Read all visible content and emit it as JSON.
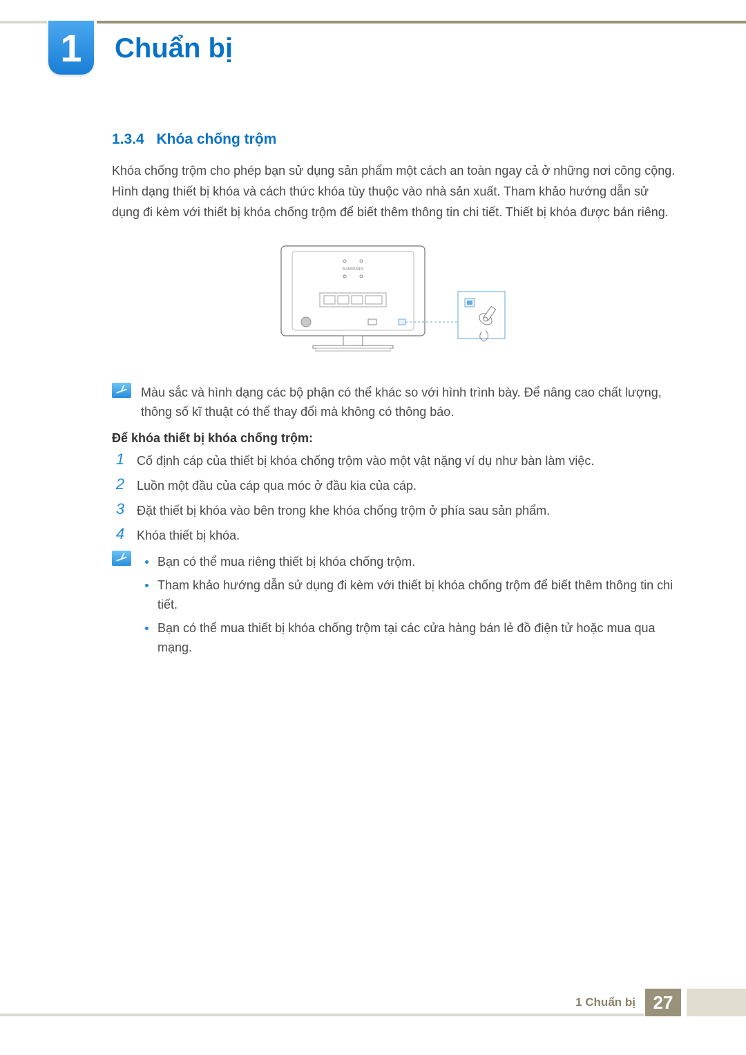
{
  "chapter": {
    "number": "1",
    "title": "Chuẩn bị"
  },
  "section": {
    "number": "1.3.4",
    "title": "Khóa chống trộm"
  },
  "paragraph": "Khóa chống trộm cho phép bạn sử dụng sản phẩm một cách an toàn ngay cả ở những nơi công cộng. Hình dạng thiết bị khóa và cách thức khóa tùy thuộc vào nhà sản xuất. Tham khảo hướng dẫn sử dụng đi kèm với thiết bị khóa chống trộm để biết thêm thông tin chi tiết. Thiết bị khóa được bán riêng.",
  "diagram": {
    "brand_label": "SAMSUNG"
  },
  "note1": "Màu sắc và hình dạng các bộ phận có thể khác so với hình trình bày. Để nâng cao chất lượng, thông số kĩ thuật có thể thay đổi mà không có thông báo.",
  "subheading": "Để khóa thiết bị khóa chống trộm:",
  "steps": [
    "Cố định cáp của thiết bị khóa chống trộm vào một vật nặng ví dụ như bàn làm việc.",
    "Luồn một đầu của cáp qua móc ở đầu kia của cáp.",
    "Đặt thiết bị khóa vào bên trong khe khóa chống trộm ở phía sau sản phẩm.",
    "Khóa thiết bị khóa."
  ],
  "note2_bullets": [
    "Bạn có thể mua riêng thiết bị khóa chống trộm.",
    "Tham khảo hướng dẫn sử dụng đi kèm với thiết bị khóa chống trộm để biết thêm thông tin chi tiết.",
    "Bạn có thể mua thiết bị khóa chống trộm tại các cửa hàng bán lẻ đồ điện tử hoặc mua qua mạng."
  ],
  "footer": {
    "label": "1 Chuẩn bị",
    "page": "27"
  }
}
